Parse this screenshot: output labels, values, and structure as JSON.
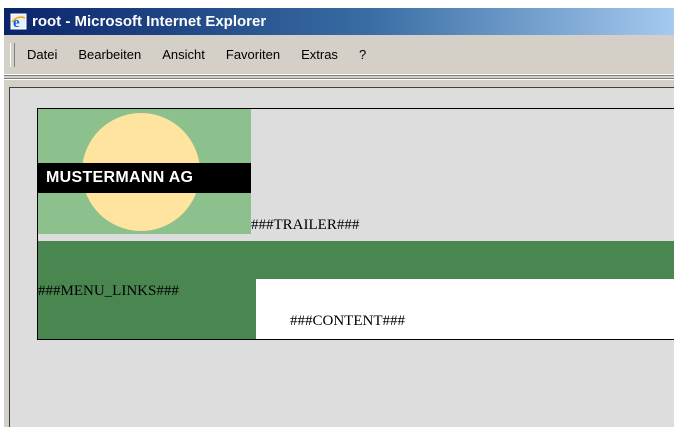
{
  "window": {
    "title": "root - Microsoft Internet Explorer",
    "icon": "ie-icon"
  },
  "menubar": {
    "items": [
      {
        "label": "Datei"
      },
      {
        "label": "Bearbeiten"
      },
      {
        "label": "Ansicht"
      },
      {
        "label": "Favoriten"
      },
      {
        "label": "Extras"
      },
      {
        "label": "?"
      }
    ]
  },
  "page": {
    "logo_text": "MUSTERMANN AG",
    "trailer": "###TRAILER###",
    "menu_links": "###MENU_LINKS###",
    "content": "###CONTENT###"
  },
  "colors": {
    "logo_background": "#8cc08c",
    "logo_circle": "#ffe4a0",
    "green_band": "#4a8650",
    "page_background": "#dddddd"
  }
}
